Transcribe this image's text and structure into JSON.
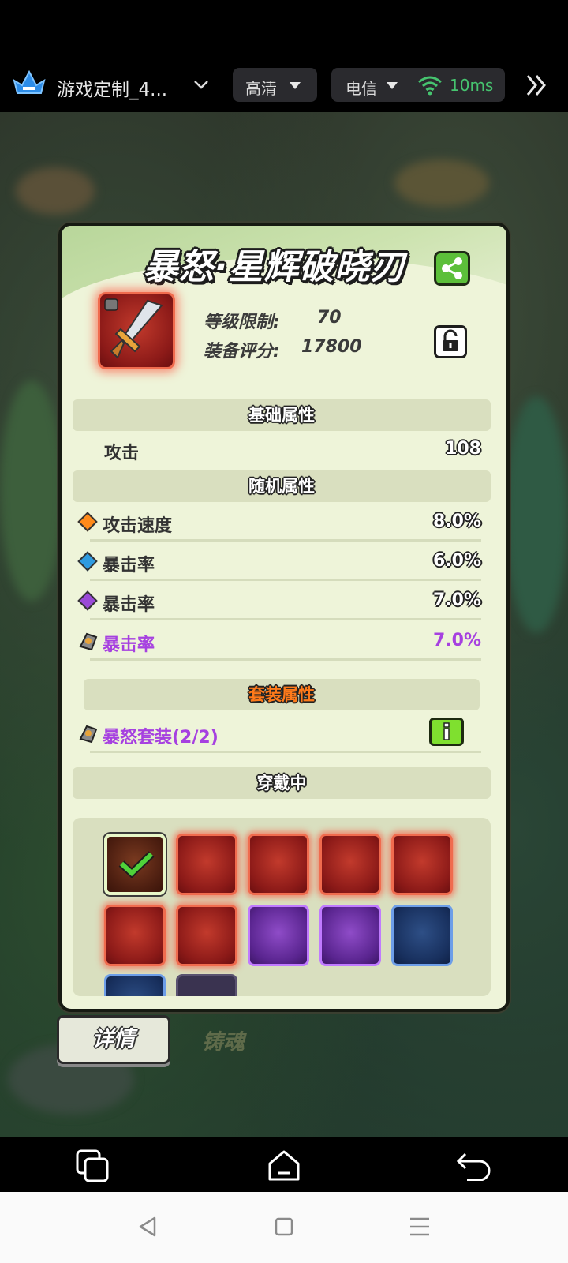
{
  "topbar": {
    "game_name": "游戏定制_4...",
    "quality": "高清",
    "network": "电信",
    "ping": "10ms"
  },
  "panel": {
    "title": "暴怒·星辉破晓刃",
    "level_limit_label": "等级限制:",
    "level_limit_value": "70",
    "score_label": "装备评分:",
    "score_value": "17800"
  },
  "sections": {
    "basic": "基础属性",
    "random": "随机属性",
    "set": "套装属性",
    "wearing": "穿戴中"
  },
  "basic_attrs": [
    {
      "name": "攻击",
      "value": "108"
    }
  ],
  "random_attrs": [
    {
      "name": "攻击速度",
      "value": "8.0%",
      "gem": "orange-gem-icon",
      "color": "#ff8a1a"
    },
    {
      "name": "暴击率",
      "value": "6.0%",
      "gem": "blue-gem-icon",
      "color": "#2f9be0"
    },
    {
      "name": "暴击率",
      "value": "7.0%",
      "gem": "purple-gem-icon",
      "color": "#9a4ad8"
    },
    {
      "name": "暴击率",
      "value": "7.0%",
      "gem": "set-rune-icon",
      "color": "#a640e0"
    }
  ],
  "set_attr": {
    "name": "暴怒套装(2/2)"
  },
  "tabs": {
    "detail": "详情",
    "soul": "铸魂"
  },
  "colors": {
    "panel_bg": "#eef4d9",
    "section_bg": "#d9dfbf",
    "ping_green": "#46c46f",
    "set_purple": "#a640e0"
  }
}
